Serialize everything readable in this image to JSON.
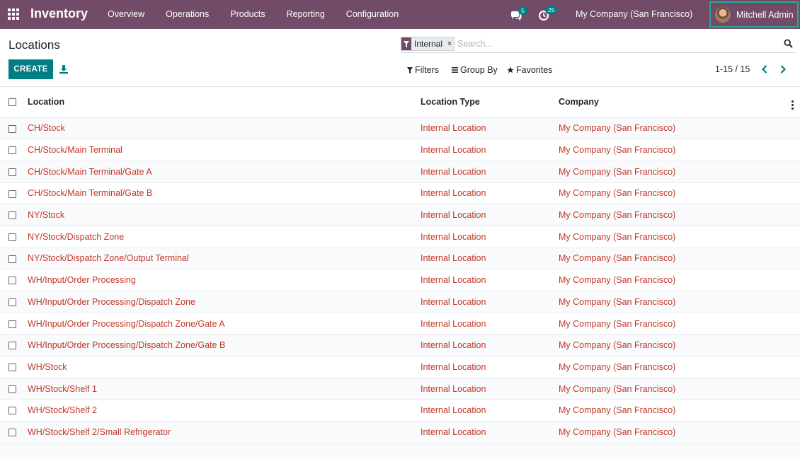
{
  "navbar": {
    "brand": "Inventory",
    "menu": [
      "Overview",
      "Operations",
      "Products",
      "Reporting",
      "Configuration"
    ],
    "messages_count": "5",
    "activities_count": "25",
    "company": "My Company (San Francisco)",
    "user": "Mitchell Admin",
    "color": "#714b67"
  },
  "control_panel": {
    "title": "Locations",
    "create_label": "CREATE",
    "search": {
      "facet": "Internal",
      "placeholder": "Search..."
    },
    "filters_label": "Filters",
    "group_by_label": "Group By",
    "favorites_label": "Favorites",
    "pager": "1-15 / 15"
  },
  "table": {
    "columns": [
      "Location",
      "Location Type",
      "Company"
    ],
    "rows": [
      {
        "location": "CH/Stock",
        "type": "Internal Location",
        "company": "My Company (San Francisco)"
      },
      {
        "location": "CH/Stock/Main Terminal",
        "type": "Internal Location",
        "company": "My Company (San Francisco)"
      },
      {
        "location": "CH/Stock/Main Terminal/Gate A",
        "type": "Internal Location",
        "company": "My Company (San Francisco)"
      },
      {
        "location": "CH/Stock/Main Terminal/Gate B",
        "type": "Internal Location",
        "company": "My Company (San Francisco)"
      },
      {
        "location": "NY/Stock",
        "type": "Internal Location",
        "company": "My Company (San Francisco)"
      },
      {
        "location": "NY/Stock/Dispatch Zone",
        "type": "Internal Location",
        "company": "My Company (San Francisco)"
      },
      {
        "location": "NY/Stock/Dispatch Zone/Output Terminal",
        "type": "Internal Location",
        "company": "My Company (San Francisco)"
      },
      {
        "location": "WH/Input/Order Processing",
        "type": "Internal Location",
        "company": "My Company (San Francisco)"
      },
      {
        "location": "WH/Input/Order Processing/Dispatch Zone",
        "type": "Internal Location",
        "company": "My Company (San Francisco)"
      },
      {
        "location": "WH/Input/Order Processing/Dispatch Zone/Gate A",
        "type": "Internal Location",
        "company": "My Company (San Francisco)"
      },
      {
        "location": "WH/Input/Order Processing/Dispatch Zone/Gate B",
        "type": "Internal Location",
        "company": "My Company (San Francisco)"
      },
      {
        "location": "WH/Stock",
        "type": "Internal Location",
        "company": "My Company (San Francisco)"
      },
      {
        "location": "WH/Stock/Shelf 1",
        "type": "Internal Location",
        "company": "My Company (San Francisco)"
      },
      {
        "location": "WH/Stock/Shelf 2",
        "type": "Internal Location",
        "company": "My Company (San Francisco)"
      },
      {
        "location": "WH/Stock/Shelf 2/Small Refrigerator",
        "type": "Internal Location",
        "company": "My Company (San Francisco)"
      }
    ]
  },
  "colors": {
    "accent": "#017e84",
    "link": "#c0392b",
    "brand": "#714b67"
  }
}
